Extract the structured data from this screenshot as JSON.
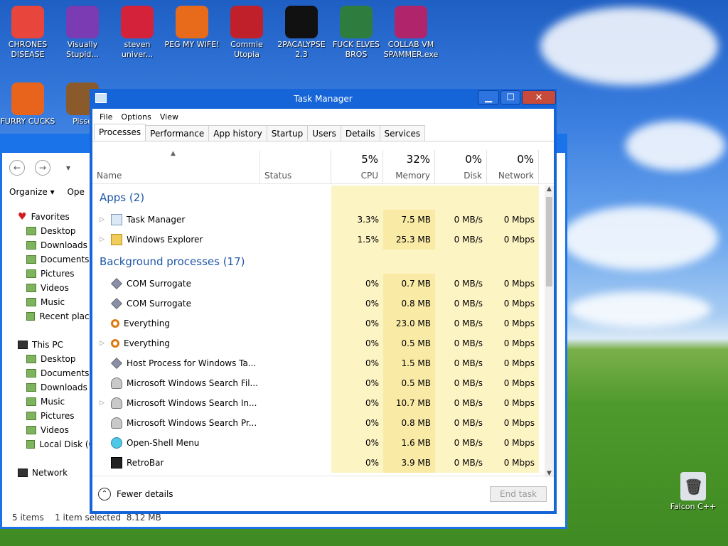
{
  "desktop": {
    "icons_top": [
      {
        "label": "CHRONES DISEASE",
        "icon": "chrome-icon",
        "color": "#e8453c"
      },
      {
        "label": "Visually Stupid...",
        "icon": "visual-studio-icon",
        "color": "#7a3bb3"
      },
      {
        "label": "steven univer...",
        "icon": "steven-icon",
        "color": "#d4223a"
      },
      {
        "label": "PEG MY WIFE!",
        "icon": "peggle-icon",
        "color": "#e86b1c"
      },
      {
        "label": "Commie Utopia",
        "icon": "game-icon",
        "color": "#c0202a"
      },
      {
        "label": "2PACALYPSE 2.3",
        "icon": "cmd-icon",
        "color": "#111111"
      },
      {
        "label": "FUCK ELVES BROS",
        "icon": "elf-icon",
        "color": "#2e7d3f"
      },
      {
        "label": "COLLAB VM SPAMMER.exe",
        "icon": "app-icon",
        "color": "#b0246b"
      }
    ],
    "icons_second": [
      {
        "label": "FURRY CUCKS",
        "icon": "firefox-icon",
        "color": "#e8641c"
      },
      {
        "label": "Pisse",
        "icon": "angry-birds-icon",
        "color": "#8a5a2a"
      }
    ],
    "recycle_bin_label": "Falcon C++"
  },
  "explorer": {
    "organize_label": "Organize",
    "open_label": "Ope",
    "favorites_label": "Favorites",
    "favorites": [
      "Desktop",
      "Downloads",
      "Documents",
      "Pictures",
      "Videos",
      "Music",
      "Recent place"
    ],
    "thispc_label": "This PC",
    "thispc": [
      "Desktop",
      "Documents",
      "Downloads",
      "Music",
      "Pictures",
      "Videos",
      "Local Disk (C"
    ],
    "network_label": "Network",
    "status": "5 items    1 item selected  8.12 MB"
  },
  "taskmanager": {
    "title": "Task Manager",
    "menu": [
      "File",
      "Options",
      "View"
    ],
    "tabs": [
      "Processes",
      "Performance",
      "App history",
      "Startup",
      "Users",
      "Details",
      "Services"
    ],
    "columns": {
      "name": "Name",
      "status": "Status",
      "cpu_pct": "5%",
      "cpu": "CPU",
      "mem_pct": "32%",
      "mem": "Memory",
      "disk_pct": "0%",
      "disk": "Disk",
      "net_pct": "0%",
      "net": "Network"
    },
    "apps_group": "Apps (2)",
    "apps": [
      {
        "name": "Task Manager",
        "icon": "taskmanager-icon",
        "cpu": "3.3%",
        "mem": "7.5 MB",
        "disk": "0 MB/s",
        "net": "0 Mbps"
      },
      {
        "name": "Windows Explorer",
        "icon": "folder-icon",
        "cpu": "1.5%",
        "mem": "25.3 MB",
        "disk": "0 MB/s",
        "net": "0 Mbps"
      }
    ],
    "bg_group": "Background processes (17)",
    "background": [
      {
        "name": "COM Surrogate",
        "icon": "diamond",
        "expand": false,
        "cpu": "0%",
        "mem": "0.7 MB",
        "disk": "0 MB/s",
        "net": "0 Mbps"
      },
      {
        "name": "COM Surrogate",
        "icon": "diamond",
        "expand": false,
        "cpu": "0%",
        "mem": "0.8 MB",
        "disk": "0 MB/s",
        "net": "0 Mbps"
      },
      {
        "name": "Everything",
        "icon": "key",
        "expand": false,
        "cpu": "0%",
        "mem": "23.0 MB",
        "disk": "0 MB/s",
        "net": "0 Mbps"
      },
      {
        "name": "Everything",
        "icon": "key",
        "expand": true,
        "cpu": "0%",
        "mem": "0.5 MB",
        "disk": "0 MB/s",
        "net": "0 Mbps"
      },
      {
        "name": "Host Process for Windows Ta...",
        "icon": "diamond",
        "expand": false,
        "cpu": "0%",
        "mem": "1.5 MB",
        "disk": "0 MB/s",
        "net": "0 Mbps"
      },
      {
        "name": "Microsoft Windows Search Fil...",
        "icon": "user",
        "expand": false,
        "cpu": "0%",
        "mem": "0.5 MB",
        "disk": "0 MB/s",
        "net": "0 Mbps"
      },
      {
        "name": "Microsoft Windows Search In...",
        "icon": "user",
        "expand": true,
        "cpu": "0%",
        "mem": "10.7 MB",
        "disk": "0 MB/s",
        "net": "0 Mbps"
      },
      {
        "name": "Microsoft Windows Search Pr...",
        "icon": "user",
        "expand": false,
        "cpu": "0%",
        "mem": "0.8 MB",
        "disk": "0 MB/s",
        "net": "0 Mbps"
      },
      {
        "name": "Open-Shell Menu",
        "icon": "shell",
        "expand": false,
        "cpu": "0%",
        "mem": "1.6 MB",
        "disk": "0 MB/s",
        "net": "0 Mbps"
      },
      {
        "name": "RetroBar",
        "icon": "bar",
        "expand": false,
        "cpu": "0%",
        "mem": "3.9 MB",
        "disk": "0 MB/s",
        "net": "0 Mbps"
      }
    ],
    "fewer_details": "Fewer details",
    "end_task": "End task"
  }
}
